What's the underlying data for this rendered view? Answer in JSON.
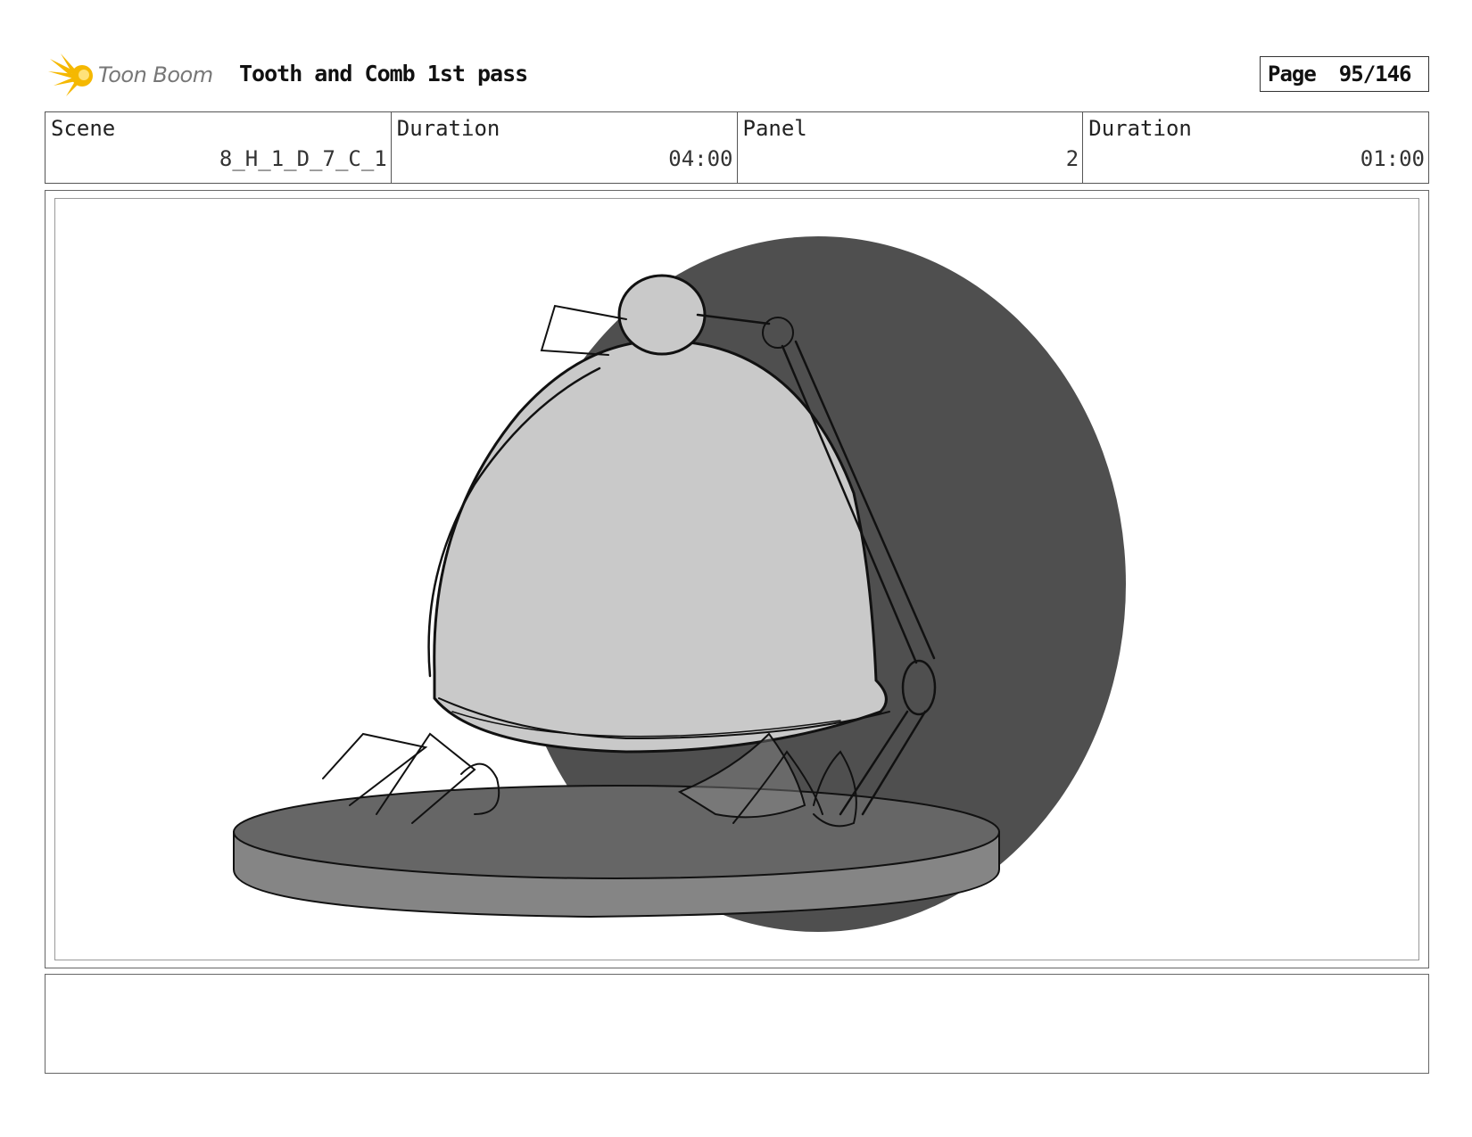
{
  "header": {
    "logo_text": "Toon Boom",
    "project_title": "Tooth and Comb 1st pass",
    "page_label": "Page",
    "page_number": "95/146"
  },
  "info": {
    "scene_label": "Scene",
    "scene_value": "8_H_1_D_7_C_1",
    "scene_duration_label": "Duration",
    "scene_duration_value": "04:00",
    "panel_label": "Panel",
    "panel_value": "2",
    "panel_duration_label": "Duration",
    "panel_duration_value": "01:00"
  },
  "colors": {
    "logo_star": "#f5b800",
    "dark_disc": "#4f4f4f",
    "dome_fill": "#c9c9c9",
    "platter_top": "#6a6a6a",
    "platter_rim": "#858585"
  },
  "panel_image": {
    "icon": "storyboard-sketch-cloche-on-platter"
  },
  "notes": {
    "text": ""
  }
}
